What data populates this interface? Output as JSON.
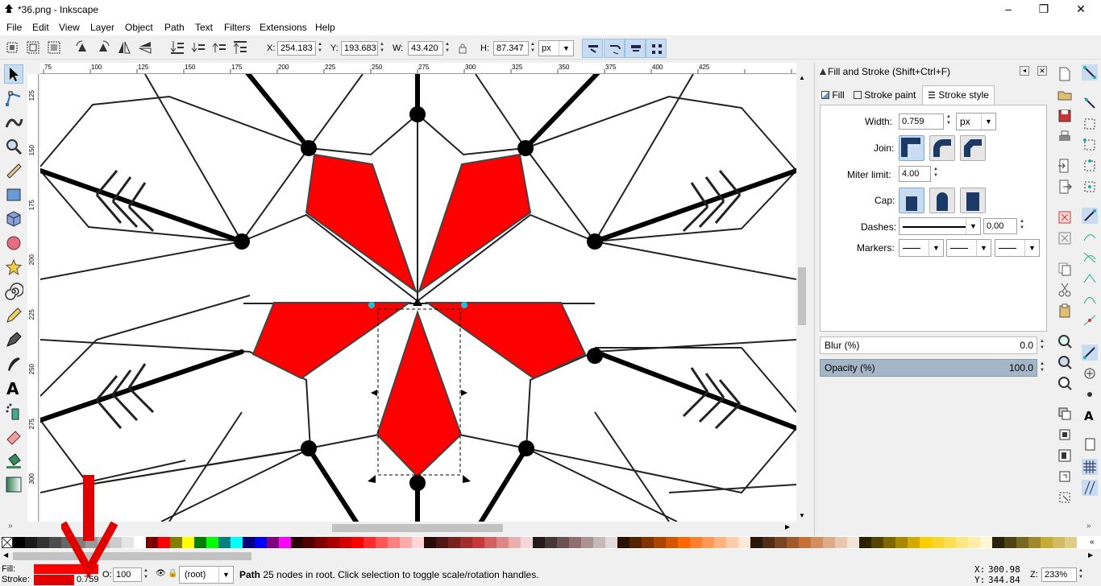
{
  "window": {
    "title": "*36.png - Inkscape",
    "minimize": "–",
    "maximize": "❐",
    "close": "✕"
  },
  "menu": [
    "File",
    "Edit",
    "View",
    "Layer",
    "Object",
    "Path",
    "Text",
    "Filters",
    "Extensions",
    "Help"
  ],
  "toolbar": {
    "x_label": "X:",
    "x_value": "254.183",
    "y_label": "Y:",
    "y_value": "193.683",
    "w_label": "W:",
    "w_value": "43.420",
    "h_label": "H:",
    "h_value": "87.347",
    "unit": "px"
  },
  "ruler_top": [
    "75",
    "100",
    "125",
    "150",
    "175",
    "200",
    "225",
    "250",
    "275",
    "300",
    "325",
    "350",
    "375",
    "400",
    "425"
  ],
  "ruler_left": [
    "125",
    "150",
    "175",
    "200",
    "225",
    "250",
    "275",
    "300"
  ],
  "dialog": {
    "title": "Fill and Stroke (Shift+Ctrl+F)",
    "tabs": [
      "Fill",
      "Stroke paint",
      "Stroke style"
    ],
    "active_tab": "Stroke style",
    "width_label": "Width:",
    "width_value": "0.759",
    "width_unit": "px",
    "join_label": "Join:",
    "miter_label": "Miter limit:",
    "miter_value": "4.00",
    "cap_label": "Cap:",
    "dashes_label": "Dashes:",
    "dashes_offset": "0.00",
    "markers_label": "Markers:",
    "blur_label": "Blur (%)",
    "blur_value": "0.0",
    "opacity_label": "Opacity (%)",
    "opacity_value": "100.0"
  },
  "palette_colors": [
    "#000000",
    "#1a1a1a",
    "#333333",
    "#4d4d4d",
    "#666666",
    "#808080",
    "#999999",
    "#b3b3b3",
    "#cccccc",
    "#e6e6e6",
    "#ffffff",
    "#800000",
    "#ff0000",
    "#808000",
    "#ffff00",
    "#008000",
    "#00ff00",
    "#008080",
    "#00ffff",
    "#000080",
    "#0000ff",
    "#800080",
    "#ff00ff",
    "#2b0000",
    "#550000",
    "#800000",
    "#aa0000",
    "#d40000",
    "#ff0000",
    "#ff2a2a",
    "#ff5555",
    "#ff8080",
    "#ffaaaa",
    "#ffd5d5",
    "#280b0b",
    "#501616",
    "#782121",
    "#a02c2c",
    "#c83737",
    "#d35f5f",
    "#de8787",
    "#e9afaf",
    "#f4d7d7",
    "#241c1c",
    "#483737",
    "#6c5353",
    "#916f6f",
    "#ac9393",
    "#c8b7b7",
    "#e3dbdb",
    "#2b1100",
    "#552200",
    "#803300",
    "#aa4400",
    "#d45500",
    "#ff6600",
    "#ff7f2a",
    "#ff9955",
    "#ffb380",
    "#ffccaa",
    "#ffe6d5",
    "#28170b",
    "#502d16",
    "#784421",
    "#a05a2c",
    "#c87137",
    "#d38d5f",
    "#deaa87",
    "#e9c6af",
    "#f4e3d7",
    "#2b2200",
    "#554400",
    "#806600",
    "#aa8800",
    "#d4aa00",
    "#ffcc00",
    "#ffd42a",
    "#ffdd55",
    "#ffe680",
    "#ffeeaa",
    "#fff6d5",
    "#28220b",
    "#504416",
    "#786721",
    "#a0892c",
    "#c8ab37",
    "#d3bc5f",
    "#decd87"
  ],
  "status": {
    "fill_label": "Fill:",
    "stroke_label": "Stroke:",
    "fill_color": "#ff0000",
    "stroke_color": "#e00000",
    "stroke_width": "0.759",
    "opacity_label": "O:",
    "opacity_value": "100",
    "layer": "(root)",
    "message_bold": "Path",
    "message": " 25 nodes in root. Click selection to toggle scale/rotation handles.",
    "x_label": "X:",
    "x_value": "300.98",
    "y_label": "Y:",
    "y_value": "344.84",
    "zoom_label": "Z:",
    "zoom_value": "233%"
  },
  "icons": {
    "tools": [
      "selector-icon",
      "node-icon",
      "tweak-icon",
      "zoom-icon",
      "measure-icon",
      "rect-icon",
      "3dbox-icon",
      "ellipse-icon",
      "star-icon",
      "spiral-icon",
      "pencil-icon",
      "pen-icon",
      "calligraphy-icon",
      "text-icon",
      "spray-icon",
      "eraser-icon",
      "paint-bucket-icon",
      "gradient-icon"
    ]
  }
}
